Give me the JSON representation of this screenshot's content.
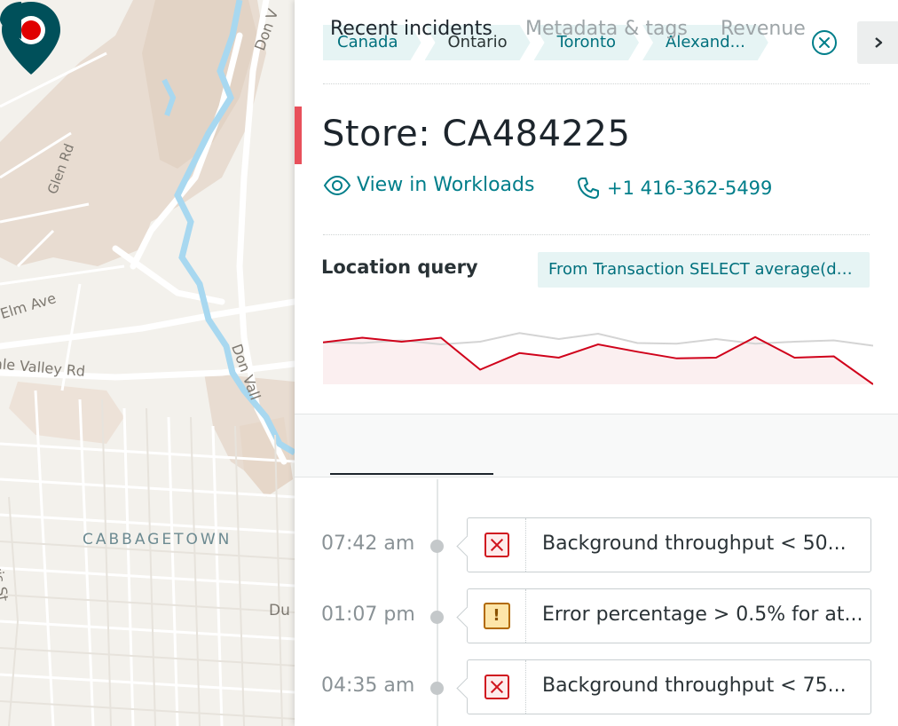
{
  "map": {
    "labels": {
      "glen_rd": "Glen Rd",
      "elm_ave": "Elm Ave",
      "vale_rd": "ale Valley Rd",
      "don_top": "Don V",
      "don_mid": "Don Vall",
      "cabbagetown": "CABBAGETOWN",
      "jarvis": "Jarvis St",
      "du": "Du"
    },
    "pin_icon": "map-pin-icon",
    "pin_color": "#00505a",
    "pin_dot_color": "#e00000"
  },
  "panel": {
    "breadcrumbs": [
      "Canada",
      "Ontario",
      "Toronto",
      "Alexand..."
    ],
    "close_icon": "close-circle-icon",
    "expand_icon": "chevron-right-icon",
    "title": "Store: CA484225",
    "view_link": "View in Workloads",
    "view_icon": "eye-icon",
    "phone": "+1 416-362-5499",
    "phone_icon": "phone-icon",
    "query_label": "Location query",
    "query_text": "From Transaction SELECT average(duration)",
    "accent_color": "#e8505b",
    "link_color": "#007e8a"
  },
  "chart_data": {
    "type": "line",
    "title": "",
    "xlabel": "",
    "ylabel": "",
    "grid": false,
    "ylim": [
      0,
      100
    ],
    "x": [
      0,
      1,
      2,
      3,
      4,
      5,
      6,
      7,
      8,
      9,
      10,
      11,
      12,
      13,
      14
    ],
    "series": [
      {
        "values": [
          63,
          62,
          66,
          60,
          64,
          77,
          68,
          76,
          62,
          61,
          68,
          61,
          64,
          66,
          58
        ],
        "color": "#d0d0d0"
      },
      {
        "values": [
          63,
          70,
          64,
          70,
          22,
          47,
          40,
          60,
          49,
          39,
          40,
          71,
          40,
          42,
          0
        ],
        "color": "#d0021b",
        "fill": true
      }
    ]
  },
  "tabs": [
    "Recent incidents",
    "Metadata & tags",
    "Revenue"
  ],
  "active_tab": "Recent incidents",
  "incidents": [
    {
      "time": "07:42 am",
      "severity": "critical",
      "icon": "critical-x-icon",
      "text": "Background throughput < 50..."
    },
    {
      "time": "01:07 pm",
      "severity": "warning",
      "icon": "warning-exclamation-icon",
      "text": "Error percentage > 0.5% for at..."
    },
    {
      "time": "04:35 am",
      "severity": "critical",
      "icon": "critical-x-icon",
      "text": "Background throughput < 75..."
    }
  ],
  "warning_glyph": "!"
}
